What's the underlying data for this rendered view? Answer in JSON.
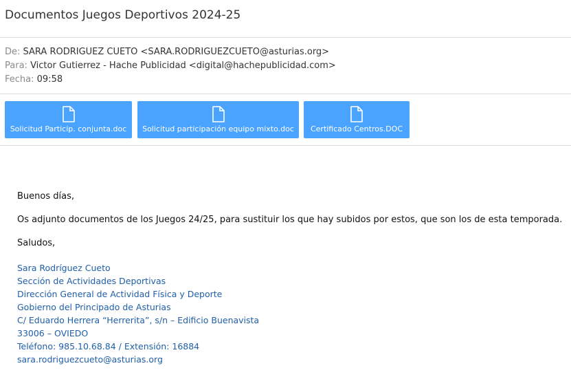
{
  "email": {
    "subject": "Documentos Juegos Deportivos 2024-25",
    "from_label": "De:",
    "from_value": "SARA RODRIGUEZ CUETO <SARA.RODRIGUEZCUETO@asturias.org>",
    "to_label": "Para:",
    "to_value": "Victor Gutierrez - Hache Publicidad <digital@hachepublicidad.com>",
    "date_label": "Fecha:",
    "date_value": "09:58"
  },
  "attachments": [
    {
      "name": "Solicitud Particip. conjunta.doc",
      "icon": "file-icon"
    },
    {
      "name": "Solicitud participación equipo mixto.doc",
      "icon": "file-icon"
    },
    {
      "name": "Certificado Centros.DOC",
      "icon": "file-icon"
    }
  ],
  "body": {
    "greeting": "Buenos días,",
    "message": "Os adjunto documentos de los Juegos 24/25, para sustituir los que hay subidos por estos, que son los de esta temporada.",
    "closing": "Saludos,"
  },
  "signature": {
    "name": "Sara Rodríguez Cueto",
    "section": "Sección de Actividades Deportivas",
    "direction": "Dirección General de Actividad Física y Deporte",
    "government": "Gobierno del Principado de Asturias",
    "address": "C/ Eduardo Herrera “Herrerita”, s/n – Edificio Buenavista",
    "city": "33006 – OVIEDO",
    "phone": "Teléfono: 985.10.68.84 / Extensión: 16884",
    "email": "sara.rodriguezcueto@asturias.org"
  },
  "colors": {
    "attachment_button": "#4aa3ff",
    "signature_text": "#1f5fa8"
  }
}
